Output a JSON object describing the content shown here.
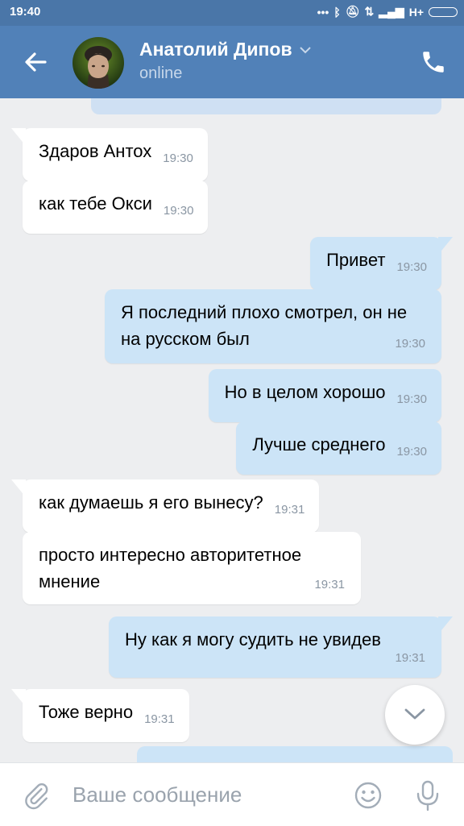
{
  "status_bar": {
    "time": "19:40",
    "network_label": "H+"
  },
  "header": {
    "contact_name": "Анатолий Дипов",
    "status": "online"
  },
  "messages": [
    {
      "direction": "in",
      "text": "Здаров Антох",
      "time": "19:30"
    },
    {
      "direction": "in",
      "text": "как тебе Окси",
      "time": "19:30"
    },
    {
      "direction": "out",
      "text": "Привет",
      "time": "19:30"
    },
    {
      "direction": "out",
      "text": "Я последний плохо смотрел, он не на русском был",
      "time": "19:30"
    },
    {
      "direction": "out",
      "text": "Но в целом хорошо",
      "time": "19:30"
    },
    {
      "direction": "out",
      "text": "Лучше среднего",
      "time": "19:30"
    },
    {
      "direction": "in",
      "text": "как думаешь я его вынесу?",
      "time": "19:31"
    },
    {
      "direction": "in",
      "text": "просто интересно авторитетное мнение",
      "time": "19:31"
    },
    {
      "direction": "out",
      "text": "Ну как я могу судить не увидев",
      "time": "19:31"
    },
    {
      "direction": "in",
      "text": "Тоже верно",
      "time": "19:31"
    }
  ],
  "composer": {
    "placeholder": "Ваше сообщение"
  },
  "colors": {
    "header": "#5181b8",
    "status_bar": "#4a76a8",
    "background": "#edeef0",
    "outgoing_bubble": "#cce4f7",
    "incoming_bubble": "#ffffff",
    "icon_gray": "#a3adb8"
  },
  "icons": [
    "back-arrow-icon",
    "chevron-down-icon",
    "phone-icon",
    "attach-icon",
    "emoji-icon",
    "microphone-icon",
    "scroll-down-chevron-icon"
  ]
}
